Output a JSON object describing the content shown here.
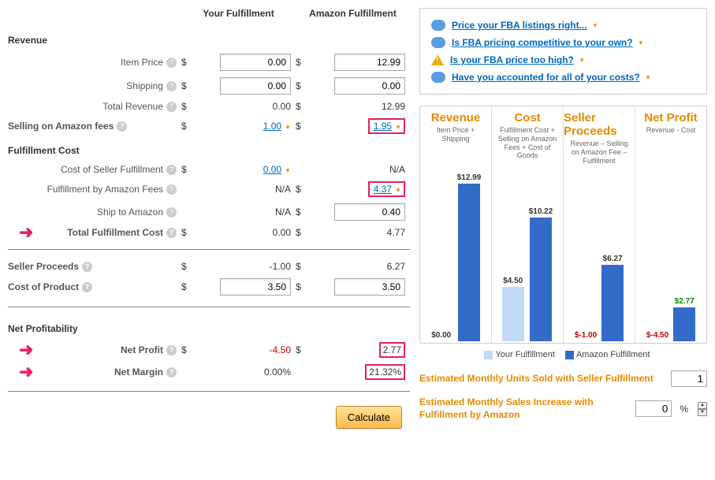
{
  "headers": {
    "your": "Your Fulfillment",
    "amz": "Amazon Fulfillment"
  },
  "sections": {
    "revenue": "Revenue",
    "fulfillment": "Fulfillment Cost",
    "netprof": "Net Profitability"
  },
  "rows": {
    "item_price": "Item Price",
    "shipping": "Shipping",
    "total_rev": "Total Revenue",
    "selling_fees": "Selling on Amazon fees",
    "cost_seller_f": "Cost of Seller Fulfillment",
    "fba_fees": "Fulfillment by Amazon Fees",
    "ship_to_amz": "Ship to Amazon",
    "total_fc": "Total Fulfillment Cost",
    "seller_proceeds": "Seller Proceeds",
    "cost_product": "Cost of Product",
    "net_profit": "Net Profit",
    "net_margin": "Net Margin"
  },
  "values": {
    "your": {
      "item_price": "0.00",
      "shipping": "0.00",
      "total_rev": "0.00",
      "selling_fees": "1.00",
      "cost_seller_f": "0.00",
      "fba_fees": "N/A",
      "ship_to_amz": "N/A",
      "total_fc": "0.00",
      "seller_proceeds": "-1.00",
      "cost_product": "3.50",
      "net_profit": "-4.50",
      "net_margin": "0.00%"
    },
    "amz": {
      "item_price": "12.99",
      "shipping": "0.00",
      "total_rev": "12.99",
      "selling_fees": "1.95",
      "cost_seller_f": "N/A",
      "fba_fees": "4.37",
      "ship_to_amz": "0.40",
      "total_fc": "4.77",
      "seller_proceeds": "6.27",
      "cost_product": "3.50",
      "net_profit": "2.77",
      "net_margin": "21.32%"
    }
  },
  "na": "N/A",
  "dollar": "$",
  "calculate": "Calculate",
  "tips": [
    "Price your FBA listings right...",
    "Is FBA pricing competitive to your own?",
    "Is your FBA price too high?",
    "Have you accounted for all of your costs?"
  ],
  "chart_data": {
    "type": "bar",
    "columns": [
      {
        "title": "Revenue",
        "sub": "Item Price + Shipping",
        "your": 0.0,
        "amz": 12.99,
        "your_label": "$0.00",
        "amz_label": "$12.99"
      },
      {
        "title": "Cost",
        "sub": "Fulfillment Cost + Selling on Amazon Fees + Cost of Goods",
        "your": 4.5,
        "amz": 10.22,
        "your_label": "$4.50",
        "amz_label": "$10.22"
      },
      {
        "title": "Seller Proceeds",
        "sub": "Revenue – Selling on Amazon Fee – Fulfillment",
        "your": -1.0,
        "amz": 6.27,
        "your_label": "$-1.00",
        "amz_label": "$6.27"
      },
      {
        "title": "Net Profit",
        "sub": "Revenue - Cost",
        "your": -4.5,
        "amz": 2.77,
        "your_label": "$-4.50",
        "amz_label": "$2.77",
        "amz_pos": true
      }
    ],
    "ymax": 12.99,
    "legend": {
      "your": "Your Fulfillment",
      "amz": "Amazon Fulfillment"
    }
  },
  "est": {
    "units_label": "Estimated Monthly Units Sold with Seller Fulfillment",
    "units_value": "1",
    "increase_label": "Estimated Monthly Sales Increase with Fulfillment by Amazon",
    "increase_value": "0",
    "pct": "%"
  }
}
